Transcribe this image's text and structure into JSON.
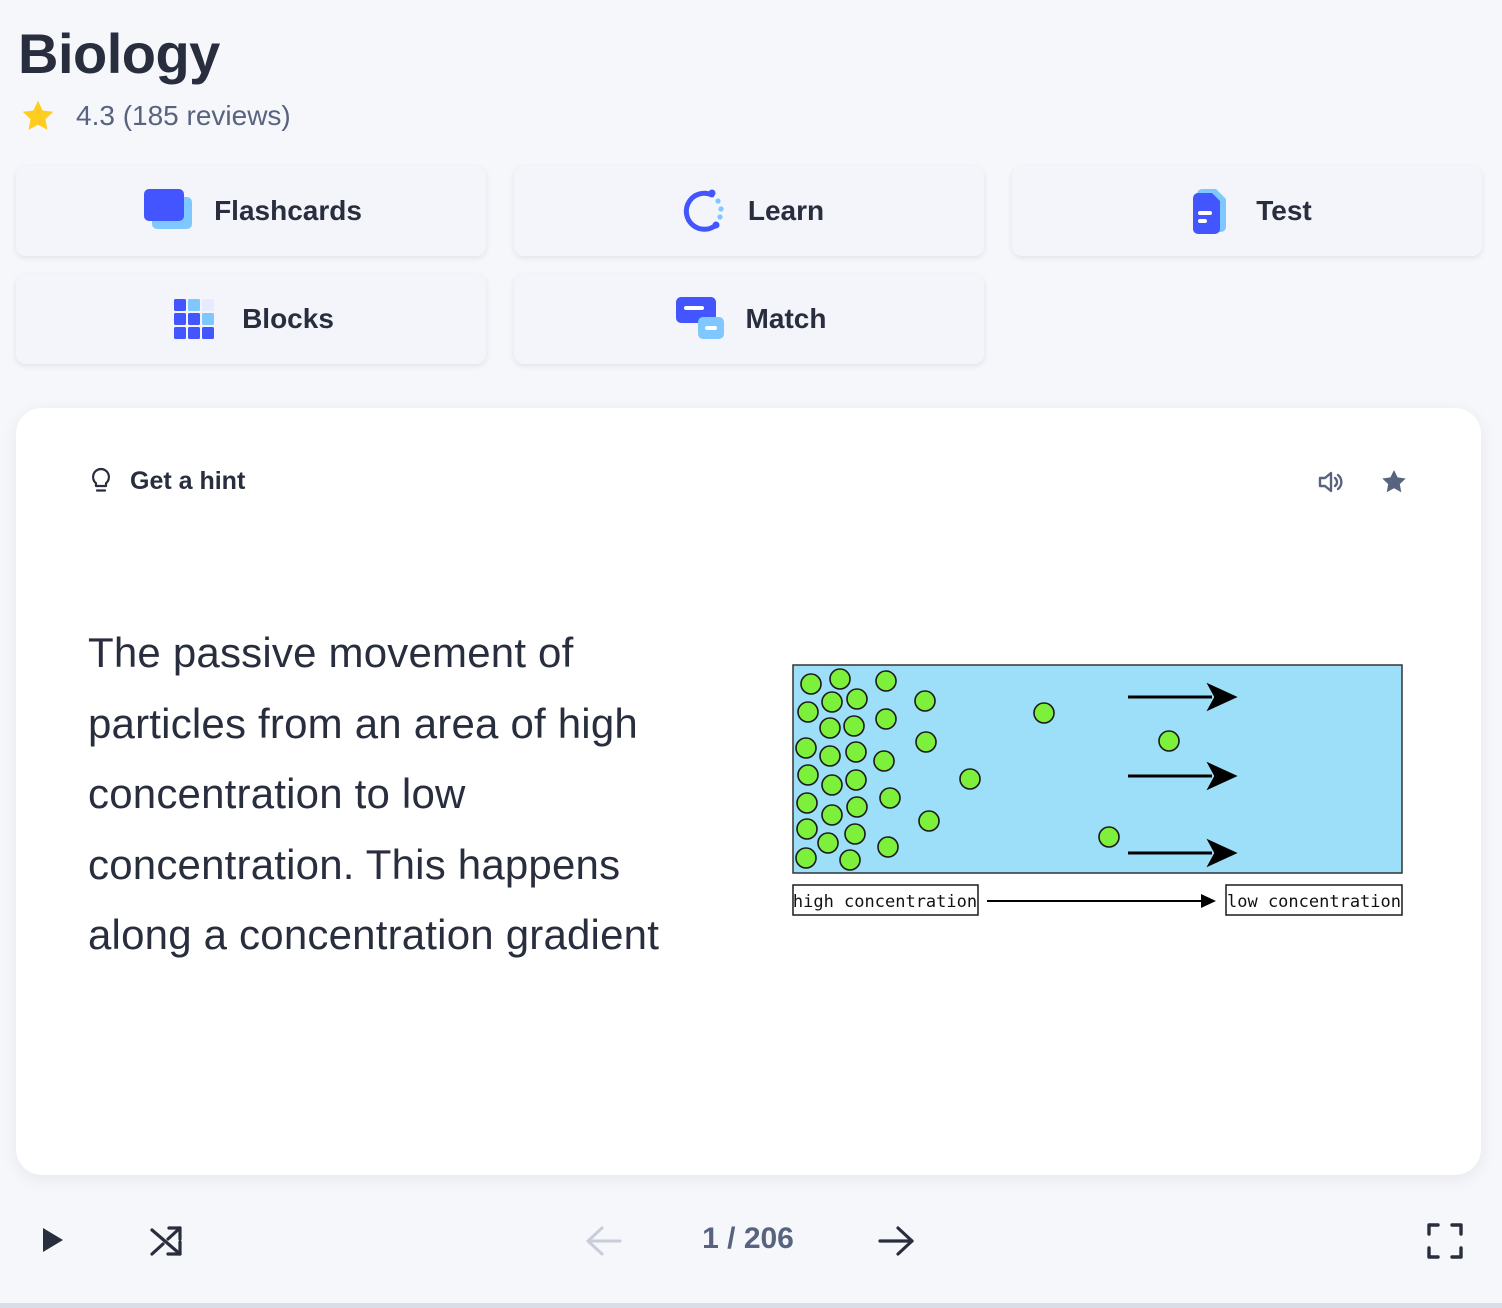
{
  "set": {
    "title": "Biology",
    "rating_text": "4.3 (185 reviews)"
  },
  "modes": [
    {
      "label": "Flashcards",
      "icon": "flashcards-icon"
    },
    {
      "label": "Learn",
      "icon": "learn-icon"
    },
    {
      "label": "Test",
      "icon": "test-icon"
    },
    {
      "label": "Blocks",
      "icon": "blocks-icon"
    },
    {
      "label": "Match",
      "icon": "match-icon"
    }
  ],
  "card": {
    "hint_label": "Get a hint",
    "definition": "The passive movement of particles from an area of high concentration to low concentration. This happens along a concentration gradient",
    "diagram": {
      "left_label": "high concentration",
      "right_label": "low concentration"
    }
  },
  "controls": {
    "counter": "1 / 206"
  },
  "colors": {
    "accent_blue": "#4255ff",
    "light_blue": "#7ec8ff",
    "star_yellow": "#ffcd1f",
    "diagram_fill": "#9ddff8",
    "particle_green": "#7cf03a"
  }
}
